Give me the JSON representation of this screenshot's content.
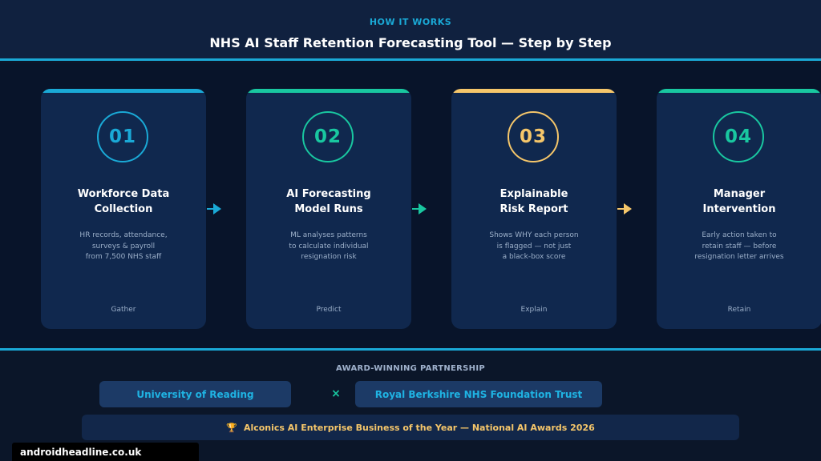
{
  "header": {
    "eyebrow": "HOW IT WORKS",
    "title": "NHS AI Staff Retention Forecasting Tool — Step by Step"
  },
  "steps": [
    {
      "number": "01",
      "name": "Workforce Data\nCollection",
      "description": "HR records, attendance,\nsurveys & payroll\nfrom 7,500 NHS staff",
      "tag": "Gather",
      "accent": "#1aa9d6"
    },
    {
      "number": "02",
      "name": "AI Forecasting\nModel Runs",
      "description": "ML analyses patterns\nto calculate individual\nresignation risk",
      "tag": "Predict",
      "accent": "#19c7a0"
    },
    {
      "number": "03",
      "name": "Explainable\nRisk Report",
      "description": "Shows WHY each person\nis flagged — not just\na black-box score",
      "tag": "Explain",
      "accent": "#f5c66a"
    },
    {
      "number": "04",
      "name": "Manager\nIntervention",
      "description": "Early action taken to\nretain staff — before\nresignation letter arrives",
      "tag": "Retain",
      "accent": "#19c7a0"
    }
  ],
  "arrows": [
    {
      "icon": "arrow-right-icon",
      "color": "#1aa9d6"
    },
    {
      "icon": "arrow-right-icon",
      "color": "#19c7a0"
    },
    {
      "icon": "arrow-right-icon",
      "color": "#f5c66a"
    }
  ],
  "partnership": {
    "heading": "AWARD-WINNING PARTNERSHIP",
    "partners": [
      "University of Reading",
      "Royal Berkshire NHS Foundation Trust"
    ],
    "separator": "×"
  },
  "award": {
    "icon": "trophy-icon",
    "glyph": "🏆",
    "text": "Alconics AI Enterprise Business of the Year — National AI Awards 2026"
  },
  "watermark": "androidheadline.co.uk"
}
